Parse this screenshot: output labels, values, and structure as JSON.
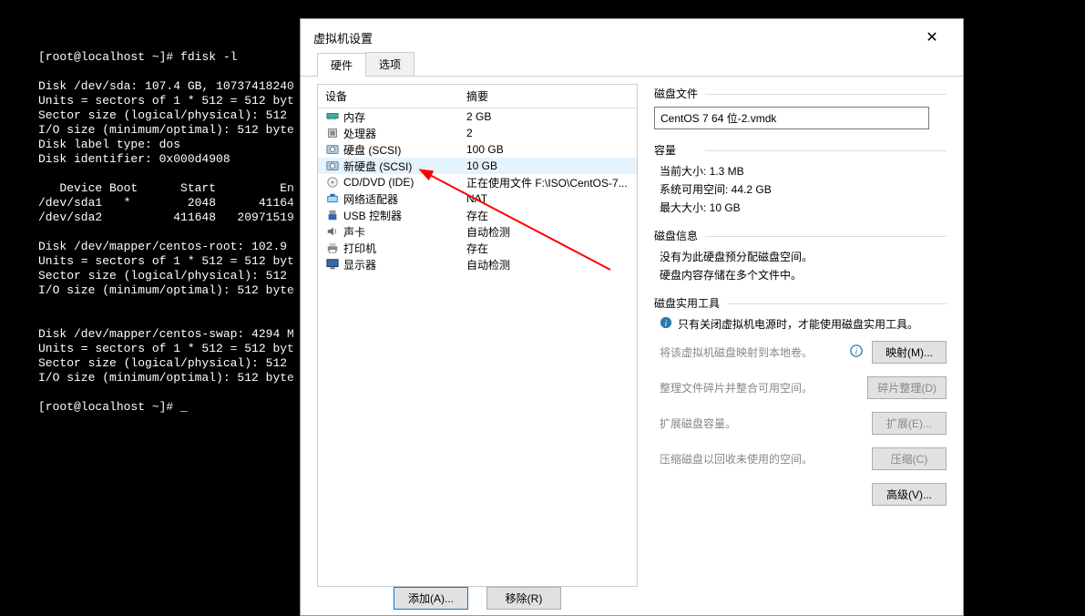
{
  "terminal": {
    "text": "[root@localhost ~]# fdisk -l\n\nDisk /dev/sda: 107.4 GB, 10737418240\nUnits = sectors of 1 * 512 = 512 byt\nSector size (logical/physical): 512 \nI/O size (minimum/optimal): 512 byte\nDisk label type: dos\nDisk identifier: 0x000d4908\n\n   Device Boot      Start         En\n/dev/sda1   *        2048      41164\n/dev/sda2          411648   20971519\n\nDisk /dev/mapper/centos-root: 102.9 \nUnits = sectors of 1 * 512 = 512 byt\nSector size (logical/physical): 512 \nI/O size (minimum/optimal): 512 byte\n\n\nDisk /dev/mapper/centos-swap: 4294 M\nUnits = sectors of 1 * 512 = 512 byt\nSector size (logical/physical): 512 \nI/O size (minimum/optimal): 512 byte\n\n[root@localhost ~]# _"
  },
  "dialog": {
    "title": "虚拟机设置",
    "tabs": {
      "hardware": "硬件",
      "options": "选项"
    },
    "headers": {
      "device": "设备",
      "summary": "摘要"
    },
    "hardware": [
      {
        "icon": "memory",
        "label": "内存",
        "summary": "2 GB"
      },
      {
        "icon": "cpu",
        "label": "处理器",
        "summary": "2"
      },
      {
        "icon": "disk",
        "label": "硬盘 (SCSI)",
        "summary": "100 GB"
      },
      {
        "icon": "disk",
        "label": "新硬盘 (SCSI)",
        "summary": "10 GB",
        "selected": true
      },
      {
        "icon": "cd",
        "label": "CD/DVD (IDE)",
        "summary": "正在使用文件 F:\\ISO\\CentOS-7..."
      },
      {
        "icon": "net",
        "label": "网络适配器",
        "summary": "NAT"
      },
      {
        "icon": "usb",
        "label": "USB 控制器",
        "summary": "存在"
      },
      {
        "icon": "sound",
        "label": "声卡",
        "summary": "自动检测"
      },
      {
        "icon": "printer",
        "label": "打印机",
        "summary": "存在"
      },
      {
        "icon": "display",
        "label": "显示器",
        "summary": "自动检测"
      }
    ],
    "disk_file": {
      "title": "磁盘文件",
      "value": "CentOS 7 64 位-2.vmdk"
    },
    "capacity": {
      "title": "容量",
      "current": "当前大小: 1.3 MB",
      "free": "系统可用空间: 44.2 GB",
      "max": "最大大小: 10 GB"
    },
    "disk_info": {
      "title": "磁盘信息",
      "line1": "没有为此硬盘预分配磁盘空间。",
      "line2": "硬盘内容存储在多个文件中。"
    },
    "tools": {
      "title": "磁盘实用工具",
      "note": "只有关闭虚拟机电源时，才能使用磁盘实用工具。",
      "map_desc": "将该虚拟机磁盘映射到本地卷。",
      "map_btn": "映射(M)...",
      "defrag_desc": "整理文件碎片并整合可用空间。",
      "defrag_btn": "碎片整理(D)",
      "expand_desc": "扩展磁盘容量。",
      "expand_btn": "扩展(E)...",
      "compact_desc": "压缩磁盘以回收未使用的空间。",
      "compact_btn": "压缩(C)"
    },
    "advanced_btn": "高级(V)...",
    "add_btn": "添加(A)...",
    "remove_btn": "移除(R)"
  }
}
